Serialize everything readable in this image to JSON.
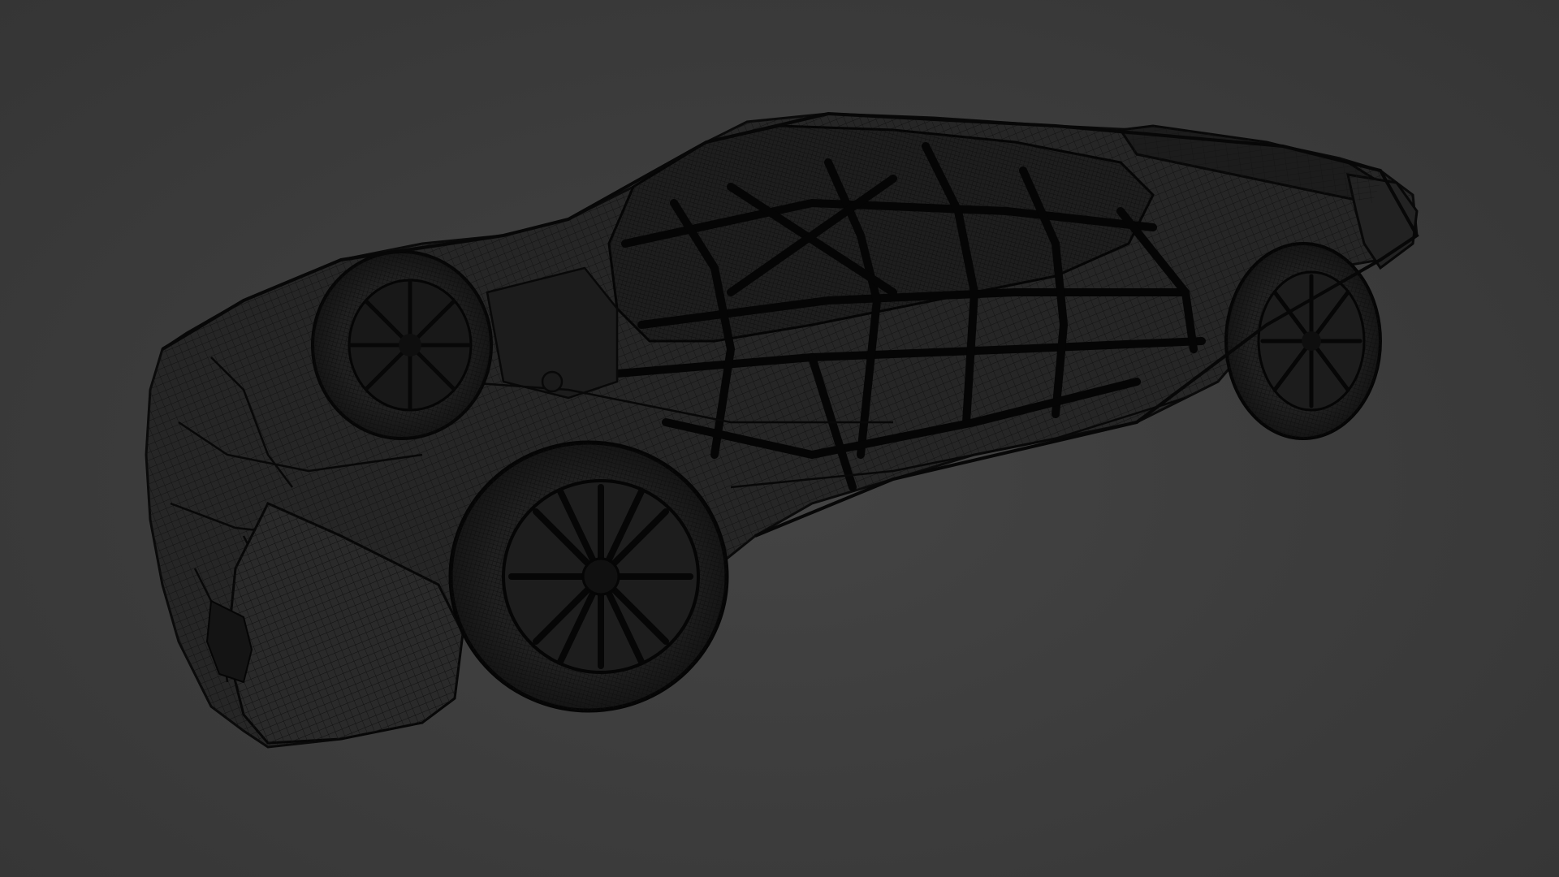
{
  "viewport": {
    "background_color": "#3a3a3a",
    "shading": "wireframe"
  },
  "model": {
    "subject": "race-car",
    "wire_color": "#0e0e0e",
    "body_color": "#262626"
  }
}
